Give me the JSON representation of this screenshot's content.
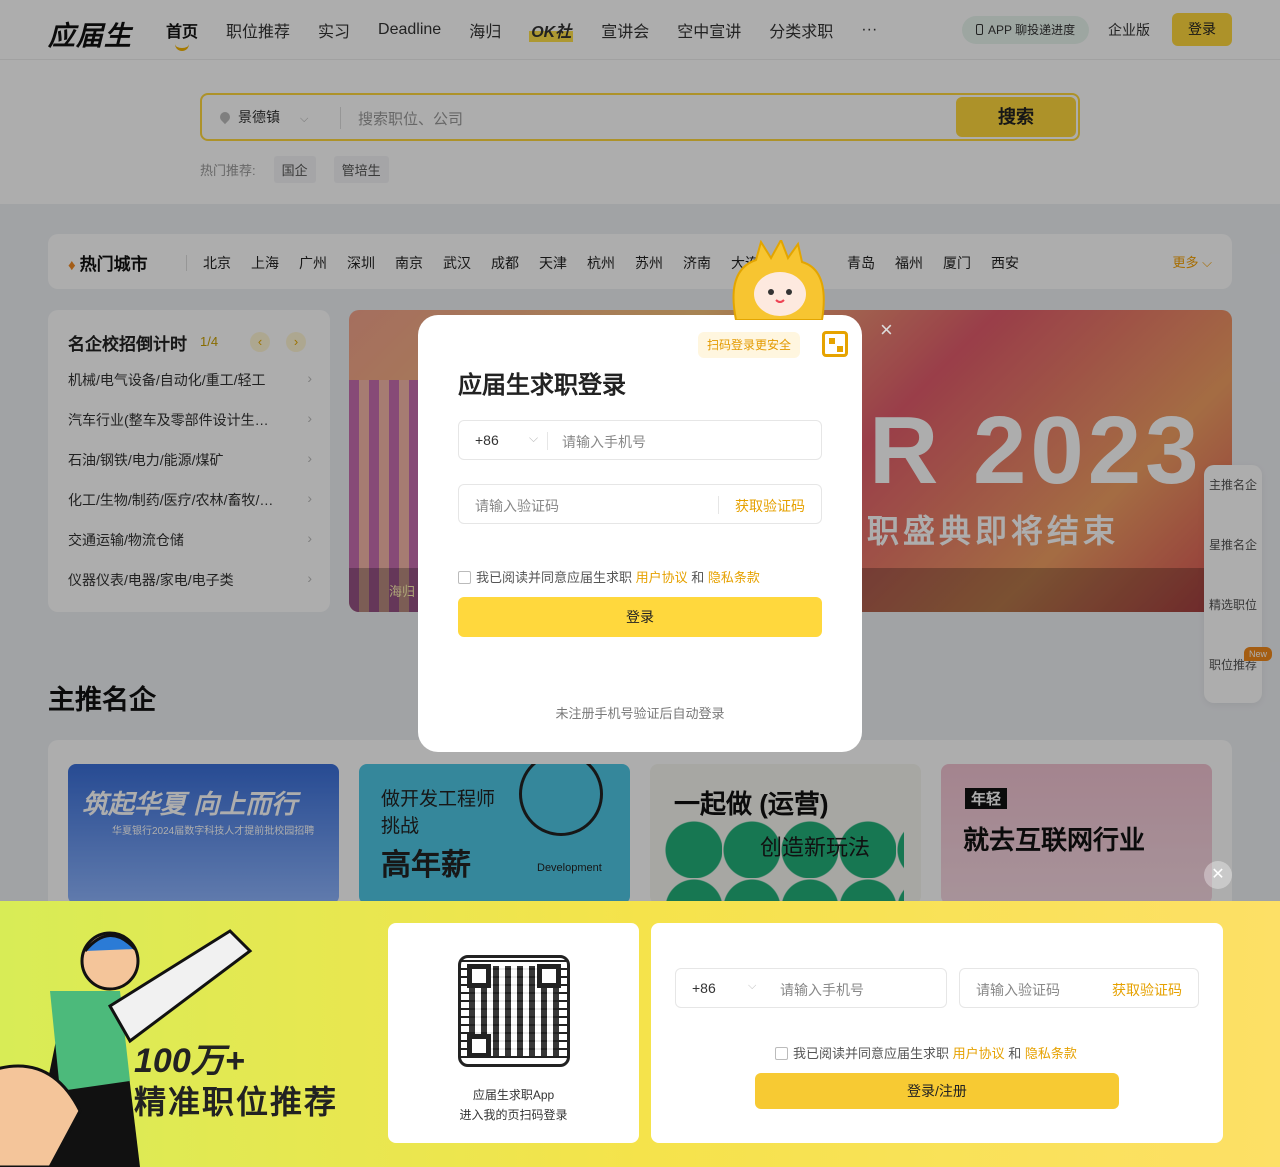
{
  "header": {
    "logo": "应届生",
    "nav": [
      "首页",
      "职位推荐",
      "实习",
      "Deadline",
      "海归",
      "OK社",
      "宣讲会",
      "空中宣讲",
      "分类求职",
      "···"
    ],
    "app_progress": "APP 聊投递进度",
    "enterprise": "企业版",
    "login": "登录"
  },
  "search": {
    "city": "景德镇",
    "placeholder": "搜索职位、公司",
    "button": "搜索",
    "hot_label": "热门推荐:",
    "hot_tags": [
      "国企",
      "管培生"
    ]
  },
  "cities": {
    "title": "热门城市",
    "list": [
      "北京",
      "上海",
      "广州",
      "深圳",
      "南京",
      "武汉",
      "成都",
      "天津",
      "杭州",
      "苏州",
      "济南",
      "大连",
      "",
      "青岛",
      "福州",
      "厦门",
      "西安"
    ],
    "more": "更多"
  },
  "countdown": {
    "title": "名企校招倒计时",
    "page": "1/4",
    "items": [
      "机械/电气设备/自动化/重工/轻工",
      "汽车行业(整车及零部件设计生…",
      "石油/钢铁/电力/能源/煤矿",
      "化工/生物/制药/医疗/农林/畜牧/…",
      "交通运输/物流仓储",
      "仪器仪表/电器/家电/电子类"
    ]
  },
  "banner": {
    "big": "R 2023",
    "sub": "职盛典即将结束",
    "tag": "海归"
  },
  "section": {
    "title": "主推名企",
    "cards": [
      {
        "title": "筑起华夏 向上而行",
        "sub": "华夏银行2024届数字科技人才提前批校园招聘"
      },
      {
        "t1": "做开发工程师",
        "t1b": "挑战",
        "t2": "高年薪",
        "t3": "Development"
      },
      {
        "t1": "一起做 (运营)",
        "t2": "创造新玩法"
      },
      {
        "t1": "年轻",
        "t2": "就去互联网行业"
      }
    ]
  },
  "sidenav": [
    "主推名企",
    "星推名企",
    "精选职位",
    "职位推荐"
  ],
  "sidenav_new": "New",
  "modal": {
    "title": "应届生求职登录",
    "qr_hint": "扫码登录更安全",
    "country_code": "+86",
    "phone_placeholder": "请输入手机号",
    "code_placeholder": "请输入验证码",
    "get_code": "获取验证码",
    "agree_text": "我已阅读并同意应届生求职",
    "user_agreement": "用户协议",
    "and": "和",
    "privacy": "隐私条款",
    "login": "登录",
    "footer": "未注册手机号验证后自动登录"
  },
  "bottom": {
    "slogan_num": "100万+",
    "slogan_text": "精准职位推荐",
    "qr_line1": "应届生求职App",
    "qr_line2": "进入我的页扫码登录",
    "country_code": "+86",
    "phone_placeholder": "请输入手机号",
    "code_placeholder": "请输入验证码",
    "get_code": "获取验证码",
    "agree_text": "我已阅读并同意应届生求职",
    "user_agreement": "用户协议",
    "and": "和",
    "privacy": "隐私条款",
    "login": "登录/注册"
  }
}
